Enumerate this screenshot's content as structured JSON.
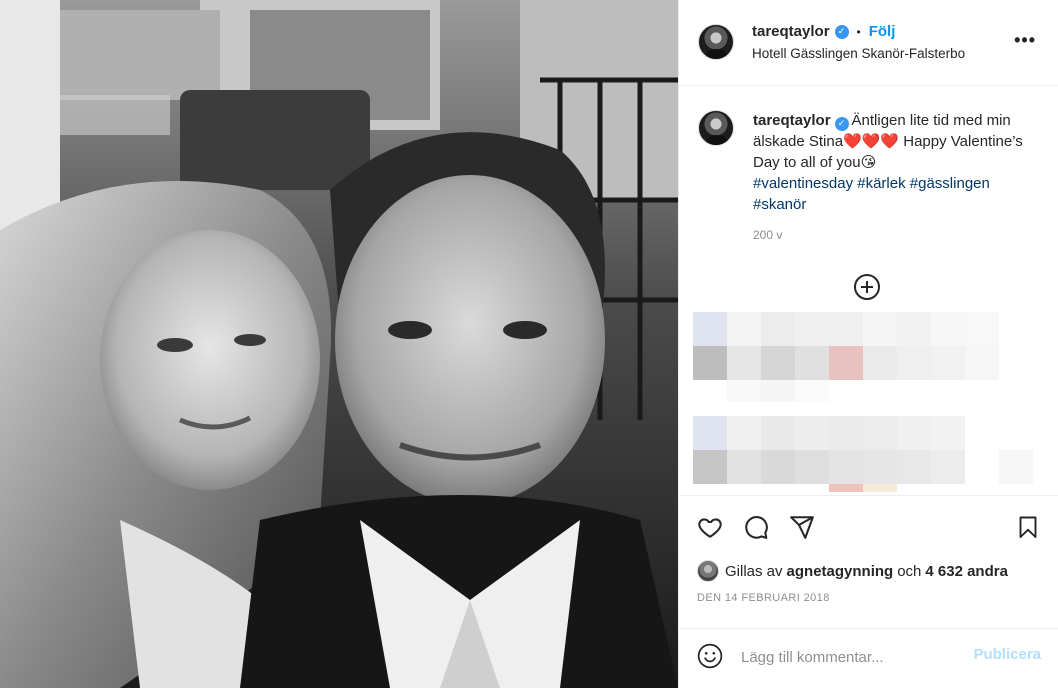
{
  "post": {
    "username": "tareqtaylor",
    "verified_badge": "✓",
    "follow_label": "Följ",
    "separator": "•",
    "location": "Hotell Gässlingen Skanör-Falsterbo",
    "more_label": "•••",
    "more_icon": "more-horizontal-icon"
  },
  "caption": {
    "username": "tareqtaylor",
    "text_part1": "Äntligen lite tid med min älskade Stina",
    "hearts": "❤️❤️❤️",
    "text_part2": " Happy Valentine’s Day to all of you",
    "kiss_emoji": "😘",
    "hashtags": [
      "#valentinesday",
      "#kärlek",
      "#gässlingen",
      "#skanör"
    ],
    "time": "200 v"
  },
  "actions": {
    "like_icon": "heart-icon",
    "comment_icon": "comment-icon",
    "share_icon": "share-icon",
    "save_icon": "bookmark-icon",
    "liked_prefix": "Gillas av",
    "liked_user": "agnetagynning",
    "liked_and": "och",
    "liked_others": "4 632 andra",
    "date": "DEN 14 FEBRUARI 2018"
  },
  "comment_bar": {
    "placeholder": "Lägg till kommentar...",
    "publish_label": "Publicera",
    "emoji_icon": "smiley-icon"
  },
  "colors": {
    "accent": "#0095f6",
    "hashtag": "#00376b",
    "muted": "#8e8e8e",
    "publish_disabled": "#b2dffc"
  }
}
